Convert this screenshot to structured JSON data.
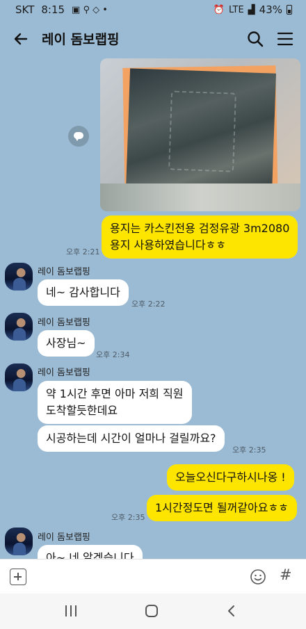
{
  "status": {
    "carrier": "SKT",
    "time": "8:15",
    "network": "LTE",
    "battery": "43%"
  },
  "header": {
    "title": "레이 돔보랩핑"
  },
  "messages": {
    "m1_text": "용지는 카스킨전용 검정유광 3m2080",
    "m1_text2": "용지 사용하였습니다ㅎㅎ",
    "m1_time": "오후 2:21",
    "m2_sender": "레이 돔보랩핑",
    "m2_text": "네~ 감사합니다",
    "m2_time": "오후 2:22",
    "m3_sender": "레이 돔보랩핑",
    "m3_text": "사장님~",
    "m3_time": "오후 2:34",
    "m4_sender": "레이 돔보랩핑",
    "m4_text": "약 1시간 후면 아마 저희 직원",
    "m4_text2": "도착할듯한데요",
    "m5_text": "시공하는데 시간이 얼마나 걸릴까요?",
    "m5_time": "오후 2:35",
    "m6_text": "오늘오신다구하시나옹 !",
    "m7_text": "1시간정도면 될꺼같아요ㅎㅎ",
    "m7_time": "오후 2:35",
    "m8_sender": "레이 돔보랩핑",
    "m8_text": "아~ 네 알겠습니다"
  },
  "icons": {
    "back": "back-arrow-icon",
    "search": "search-icon",
    "menu": "hamburger-menu-icon",
    "share": "share-icon",
    "plus": "plus-icon",
    "emoji": "emoji-icon",
    "hash": "#"
  }
}
